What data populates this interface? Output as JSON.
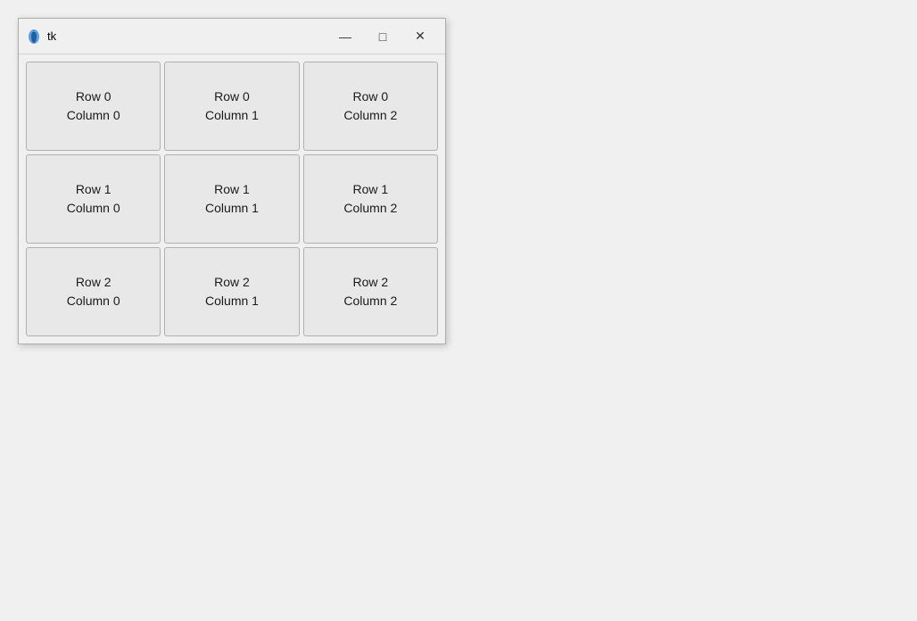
{
  "window": {
    "title": "tk",
    "controls": {
      "minimize": "—",
      "maximize": "□",
      "close": "✕"
    }
  },
  "grid": {
    "cells": [
      {
        "row": 0,
        "col": 0,
        "label": "Row 0\nColumn 0"
      },
      {
        "row": 0,
        "col": 1,
        "label": "Row 0\nColumn 1"
      },
      {
        "row": 0,
        "col": 2,
        "label": "Row 0\nColumn 2"
      },
      {
        "row": 1,
        "col": 0,
        "label": "Row 1\nColumn 0"
      },
      {
        "row": 1,
        "col": 1,
        "label": "Row 1\nColumn 1"
      },
      {
        "row": 1,
        "col": 2,
        "label": "Row 1\nColumn 2"
      },
      {
        "row": 2,
        "col": 0,
        "label": "Row 2\nColumn 0"
      },
      {
        "row": 2,
        "col": 1,
        "label": "Row 2\nColumn 1"
      },
      {
        "row": 2,
        "col": 2,
        "label": "Row 2\nColumn 2"
      }
    ]
  }
}
